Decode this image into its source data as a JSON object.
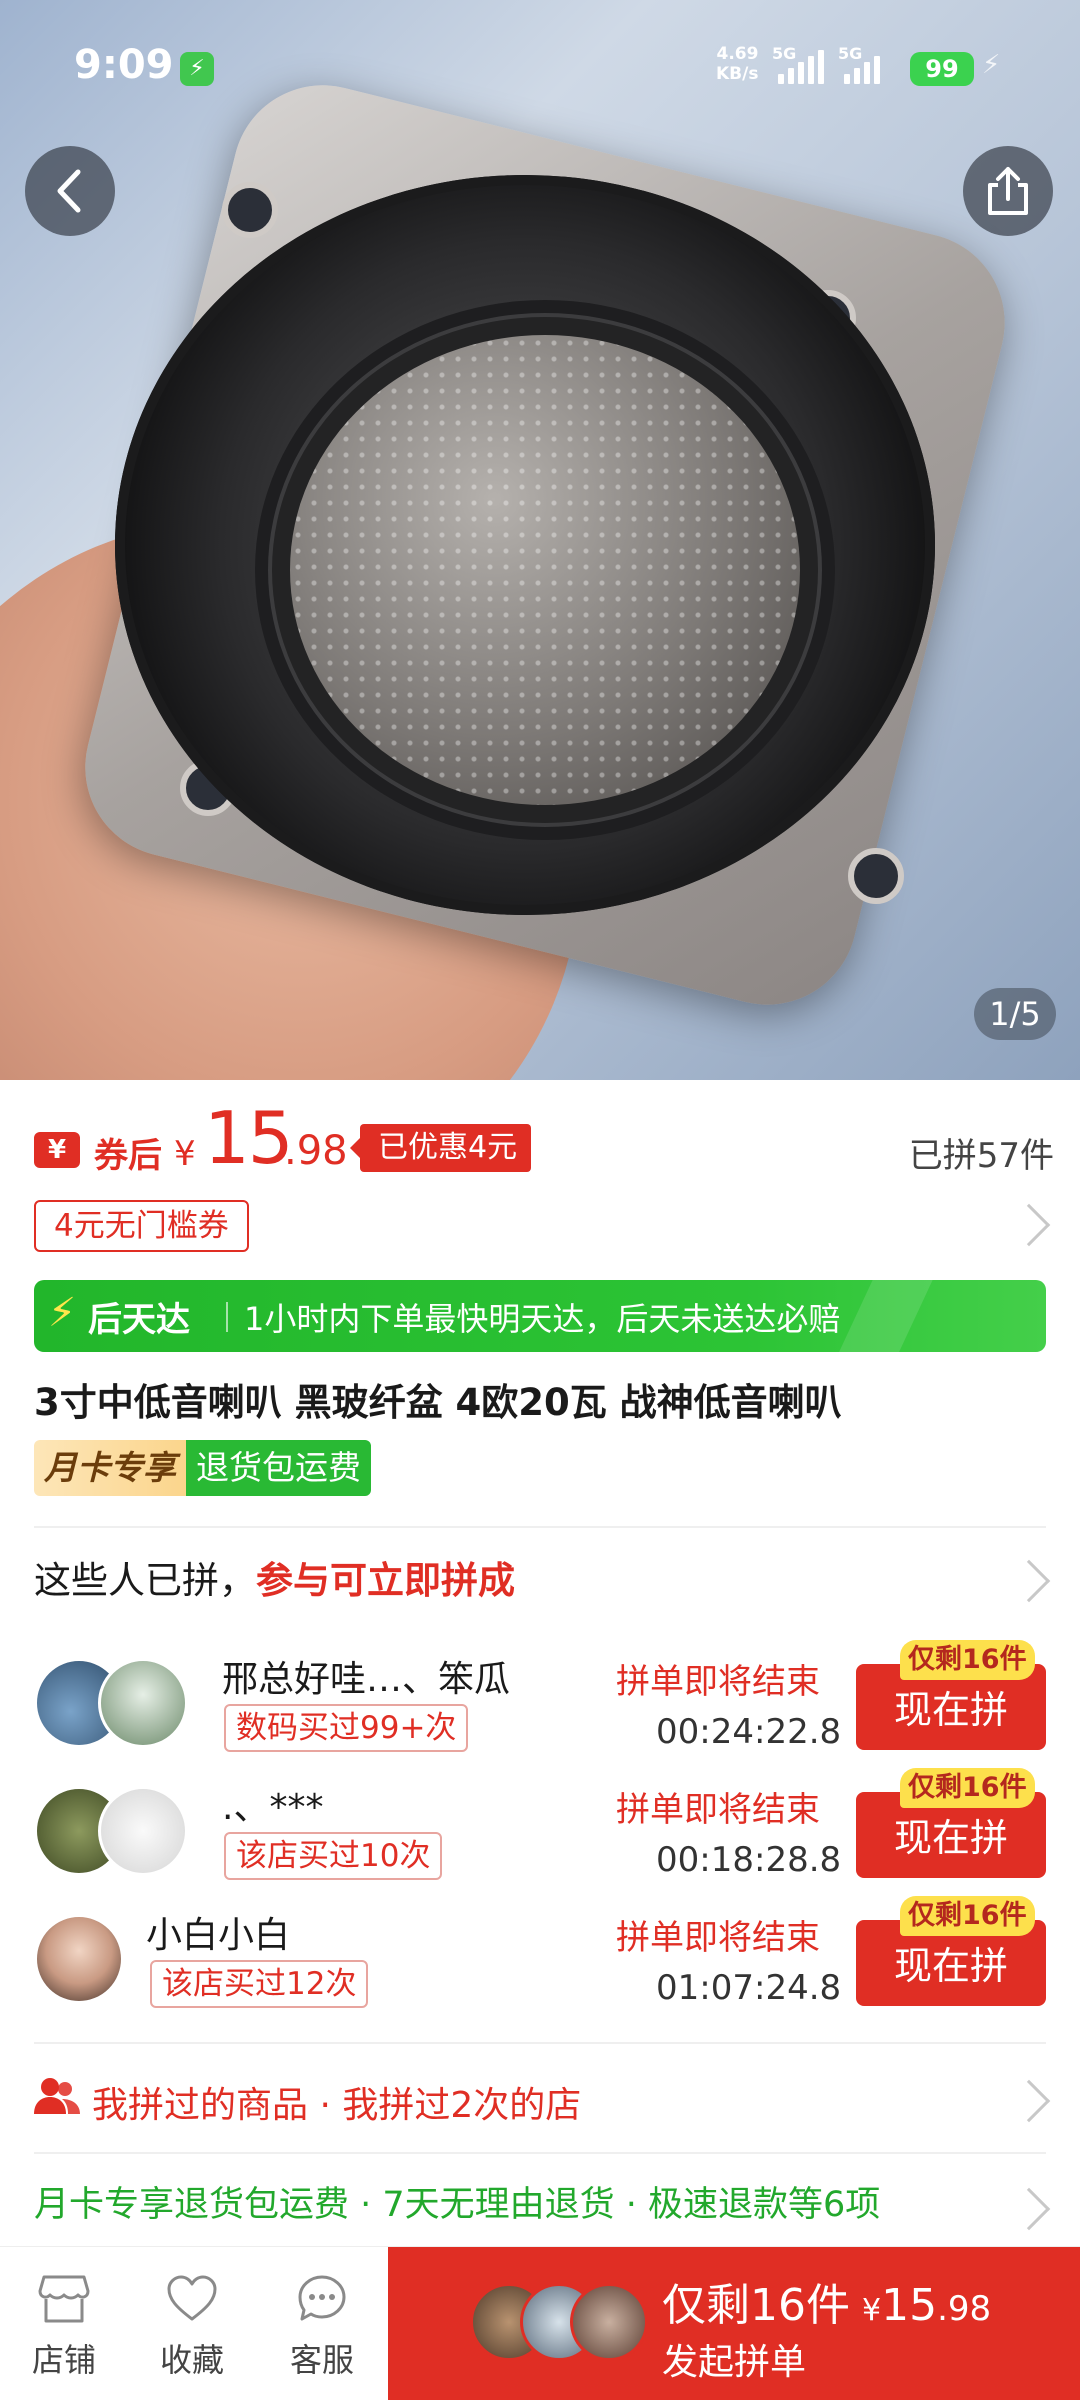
{
  "status_bar": {
    "time": "9:09",
    "net_speed_value": "4.69",
    "net_speed_unit": "KB/s",
    "sim1": "5G",
    "sim2": "5G",
    "battery": "99"
  },
  "gallery": {
    "counter": "1/5"
  },
  "price": {
    "tag_icon": "¥",
    "after_coupon": "券后",
    "currency": "¥",
    "integer": "15",
    "decimal": ".98",
    "discount": "已优惠4元",
    "sold": "已拼57件"
  },
  "coupon": {
    "label": "4元无门槛券"
  },
  "delivery": {
    "brand": "后天达",
    "promise": "1小时内下单最快明天达，后天未送达必赔"
  },
  "product": {
    "title": "3寸中低音喇叭 黑玻纤盆 4欧20瓦 战神低音喇叭"
  },
  "tags": {
    "month_card": "月卡专享",
    "return_shipping": "退货包运费"
  },
  "groups_header": {
    "lead": "这些人已拼，",
    "highlight": "参与可立即拼成"
  },
  "groups": [
    {
      "name": "邢总好哇…、笨瓜",
      "badge": "数码买过99+次",
      "status": "拼单即将结束",
      "timer": "00:24:22.8",
      "button": "现在拼",
      "remaining": "仅剩16件"
    },
    {
      "name": ".、***",
      "badge": "该店买过10次",
      "status": "拼单即将结束",
      "timer": "00:18:28.8",
      "button": "现在拼",
      "remaining": "仅剩16件"
    },
    {
      "name": "小白小白",
      "badge": "该店买过12次",
      "status": "拼单即将结束",
      "timer": "01:07:24.8",
      "button": "现在拼",
      "remaining": "仅剩16件"
    }
  ],
  "history": {
    "label": "我拼过的商品 · 我拼过2次的店"
  },
  "perks": {
    "label": "月卡专享退货包运费 · 7天无理由退货 · 极速退款等6项"
  },
  "bottom_nav": {
    "store": "店铺",
    "favorite": "收藏",
    "service": "客服"
  },
  "cta": {
    "remaining": "仅剩16件",
    "currency": "¥",
    "integer": "15",
    "decimal": ".98",
    "action": "发起拼单"
  },
  "colors": {
    "brand_red": "#e02e24",
    "green": "#29b934",
    "yellow": "#fde04c"
  }
}
